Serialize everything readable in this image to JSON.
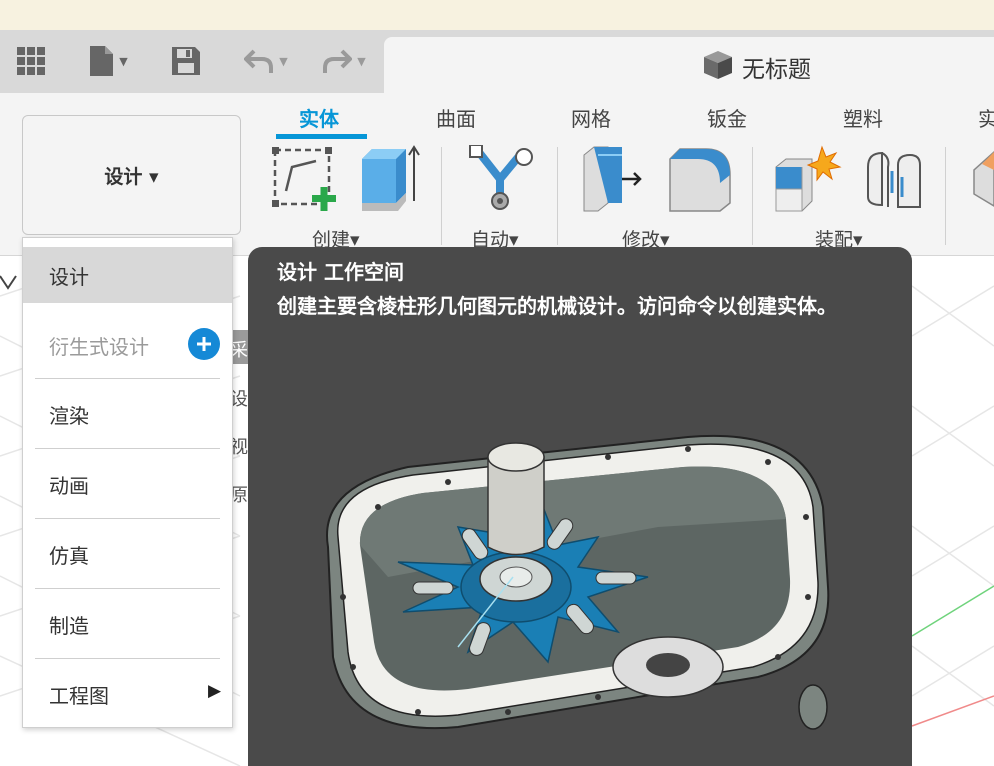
{
  "window": {
    "doc_title": "无标题"
  },
  "toolbar": {
    "grid_icon": "app-grid-icon",
    "file_icon": "file-icon",
    "save_icon": "save-icon",
    "undo_icon": "undo-icon",
    "redo_icon": "redo-icon",
    "cube_icon": "document-cube-icon"
  },
  "workspace": {
    "current": "设计 ▾"
  },
  "ribbon": {
    "tabs": [
      {
        "label": "实体",
        "active": true
      },
      {
        "label": "曲面",
        "active": false
      },
      {
        "label": "网格",
        "active": false
      },
      {
        "label": "钣金",
        "active": false
      },
      {
        "label": "塑料",
        "active": false
      },
      {
        "label": "实",
        "active": false
      }
    ],
    "groups": [
      {
        "label": "创建▾"
      },
      {
        "label": "自动▾"
      },
      {
        "label": "修改▾"
      },
      {
        "label": "装配▾"
      }
    ]
  },
  "workspace_menu": {
    "items": [
      {
        "label": "设计"
      },
      {
        "label": "衍生式设计"
      },
      {
        "label": "渲染"
      },
      {
        "label": "动画"
      },
      {
        "label": "仿真"
      },
      {
        "label": "制造"
      },
      {
        "label": "工程图"
      }
    ]
  },
  "hidden_panel": {
    "fragments": [
      "采",
      "设",
      "视",
      "原"
    ]
  },
  "tooltip": {
    "title": "设计  工作空间",
    "description": "创建主要含棱柱形几何图元的机械设计。访问命令以创建实体。"
  },
  "colors": {
    "accent": "#0696d7",
    "tooltip_bg": "#4a4a4a",
    "part_blue": "#1a7fb5"
  }
}
